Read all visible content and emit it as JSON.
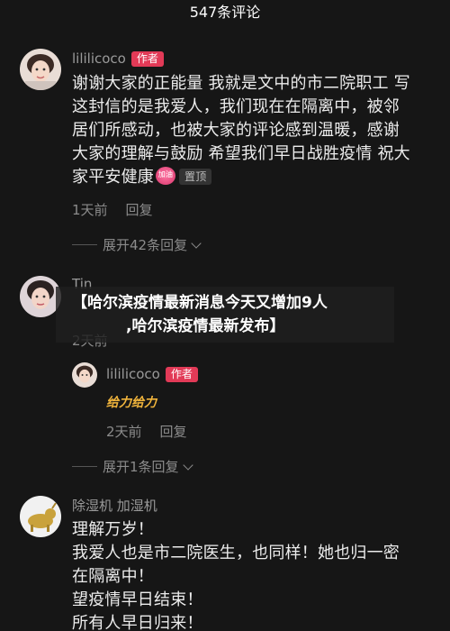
{
  "header": {
    "title": "547条评论"
  },
  "comments": [
    {
      "user": "lililicoco",
      "badge": "作者",
      "lines": [
        "谢谢大家的正能量 我就是文中的市二院职工 写",
        "这封信的是我爱人，我们现在在隔离中，被邻",
        "居们所感动，也被大家的评论感到温暖，感谢",
        "大家的理解与鼓励 希望我们早日战胜疫情 祝大",
        "家平安健康"
      ],
      "sticker": "加油",
      "pin": "置顶",
      "time": "1天前",
      "reply": "回复",
      "expand": "展开42条回复"
    },
    {
      "user": "Tin",
      "time": "2天前",
      "reply_user": {
        "user": "lililicoco",
        "badge": "作者",
        "text": "给力给力",
        "time": "2天前",
        "reply": "回复"
      },
      "expand": "展开1条回复"
    },
    {
      "user": "除湿机 加湿机",
      "lines": [
        "理解万岁！",
        "我爱人也是市二院医生，也同样！她也归一密",
        "在隔离中！",
        "望疫情早日结束！",
        "所有人早日归来！"
      ]
    }
  ],
  "overlay": {
    "line1": "【哈尔滨疫情最新消息今天又增加9人",
    "line2": ",哈尔滨疫情最新发布】"
  },
  "colors": {
    "background": "#161616",
    "badge": "#e23a57",
    "muted": "#8b8b8b"
  }
}
